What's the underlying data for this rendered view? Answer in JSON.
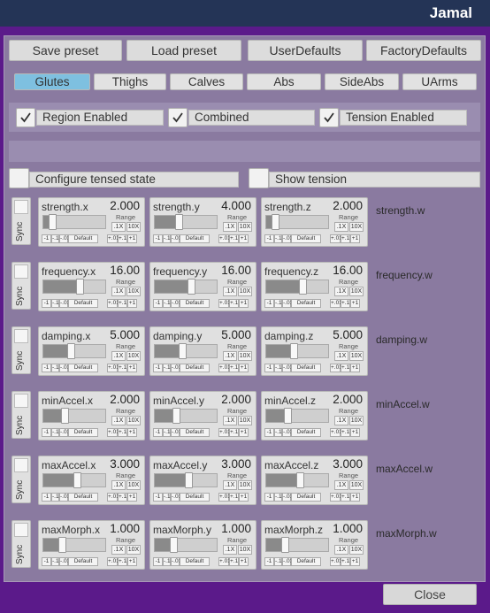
{
  "window": {
    "title": "Jamal"
  },
  "presets": [
    "Save preset",
    "Load preset",
    "UserDefaults",
    "FactoryDefaults"
  ],
  "tabs": [
    {
      "label": "Glutes",
      "active": true
    },
    {
      "label": "Thighs",
      "active": false
    },
    {
      "label": "Calves",
      "active": false
    },
    {
      "label": "Abs",
      "active": false
    },
    {
      "label": "SideAbs",
      "active": false
    },
    {
      "label": "UArms",
      "active": false
    }
  ],
  "toggles": [
    {
      "label": "Region Enabled",
      "checked": true
    },
    {
      "label": "Combined",
      "checked": true
    },
    {
      "label": "Tension Enabled",
      "checked": true
    }
  ],
  "options": [
    {
      "label": "Configure tensed state",
      "checked": false
    },
    {
      "label": "Show tension",
      "checked": false
    }
  ],
  "sync_label": "Sync",
  "range_label": "Range",
  "range_buttons": [
    ".1X",
    "10X"
  ],
  "step_buttons": [
    "-1",
    "-.1",
    "-.01",
    "Default",
    "+.01",
    "+.1",
    "+1"
  ],
  "params": [
    {
      "w_label": "strength.w",
      "sliders": [
        {
          "label": "strength.x",
          "value": "2.000",
          "level": 0.1
        },
        {
          "label": "strength.y",
          "value": "4.000",
          "level": 0.38
        },
        {
          "label": "strength.z",
          "value": "2.000",
          "level": 0.1
        }
      ]
    },
    {
      "w_label": "frequency.w",
      "sliders": [
        {
          "label": "frequency.x",
          "value": "16.00",
          "level": 0.6
        },
        {
          "label": "frequency.y",
          "value": "16.00",
          "level": 0.6
        },
        {
          "label": "frequency.z",
          "value": "16.00",
          "level": 0.6
        }
      ]
    },
    {
      "w_label": "damping.w",
      "sliders": [
        {
          "label": "damping.x",
          "value": "5.000",
          "level": 0.45
        },
        {
          "label": "damping.y",
          "value": "5.000",
          "level": 0.45
        },
        {
          "label": "damping.z",
          "value": "5.000",
          "level": 0.45
        }
      ]
    },
    {
      "w_label": "minAccel.w",
      "sliders": [
        {
          "label": "minAccel.x",
          "value": "2.000",
          "level": 0.33
        },
        {
          "label": "minAccel.y",
          "value": "2.000",
          "level": 0.33
        },
        {
          "label": "minAccel.z",
          "value": "2.000",
          "level": 0.33
        }
      ]
    },
    {
      "w_label": "maxAccel.w",
      "sliders": [
        {
          "label": "maxAccel.x",
          "value": "3.000",
          "level": 0.55
        },
        {
          "label": "maxAccel.y",
          "value": "3.000",
          "level": 0.55
        },
        {
          "label": "maxAccel.z",
          "value": "3.000",
          "level": 0.55
        }
      ]
    },
    {
      "w_label": "maxMorph.w",
      "sliders": [
        {
          "label": "maxMorph.x",
          "value": "1.000",
          "level": 0.28
        },
        {
          "label": "maxMorph.y",
          "value": "1.000",
          "level": 0.28
        },
        {
          "label": "maxMorph.z",
          "value": "1.000",
          "level": 0.28
        }
      ]
    }
  ],
  "close_label": "Close",
  "colors": {
    "accent_tab": "#7ec0e0",
    "titlebar": "#243456",
    "frame": "#5b1a8a",
    "panel": "#8a7aa0"
  }
}
